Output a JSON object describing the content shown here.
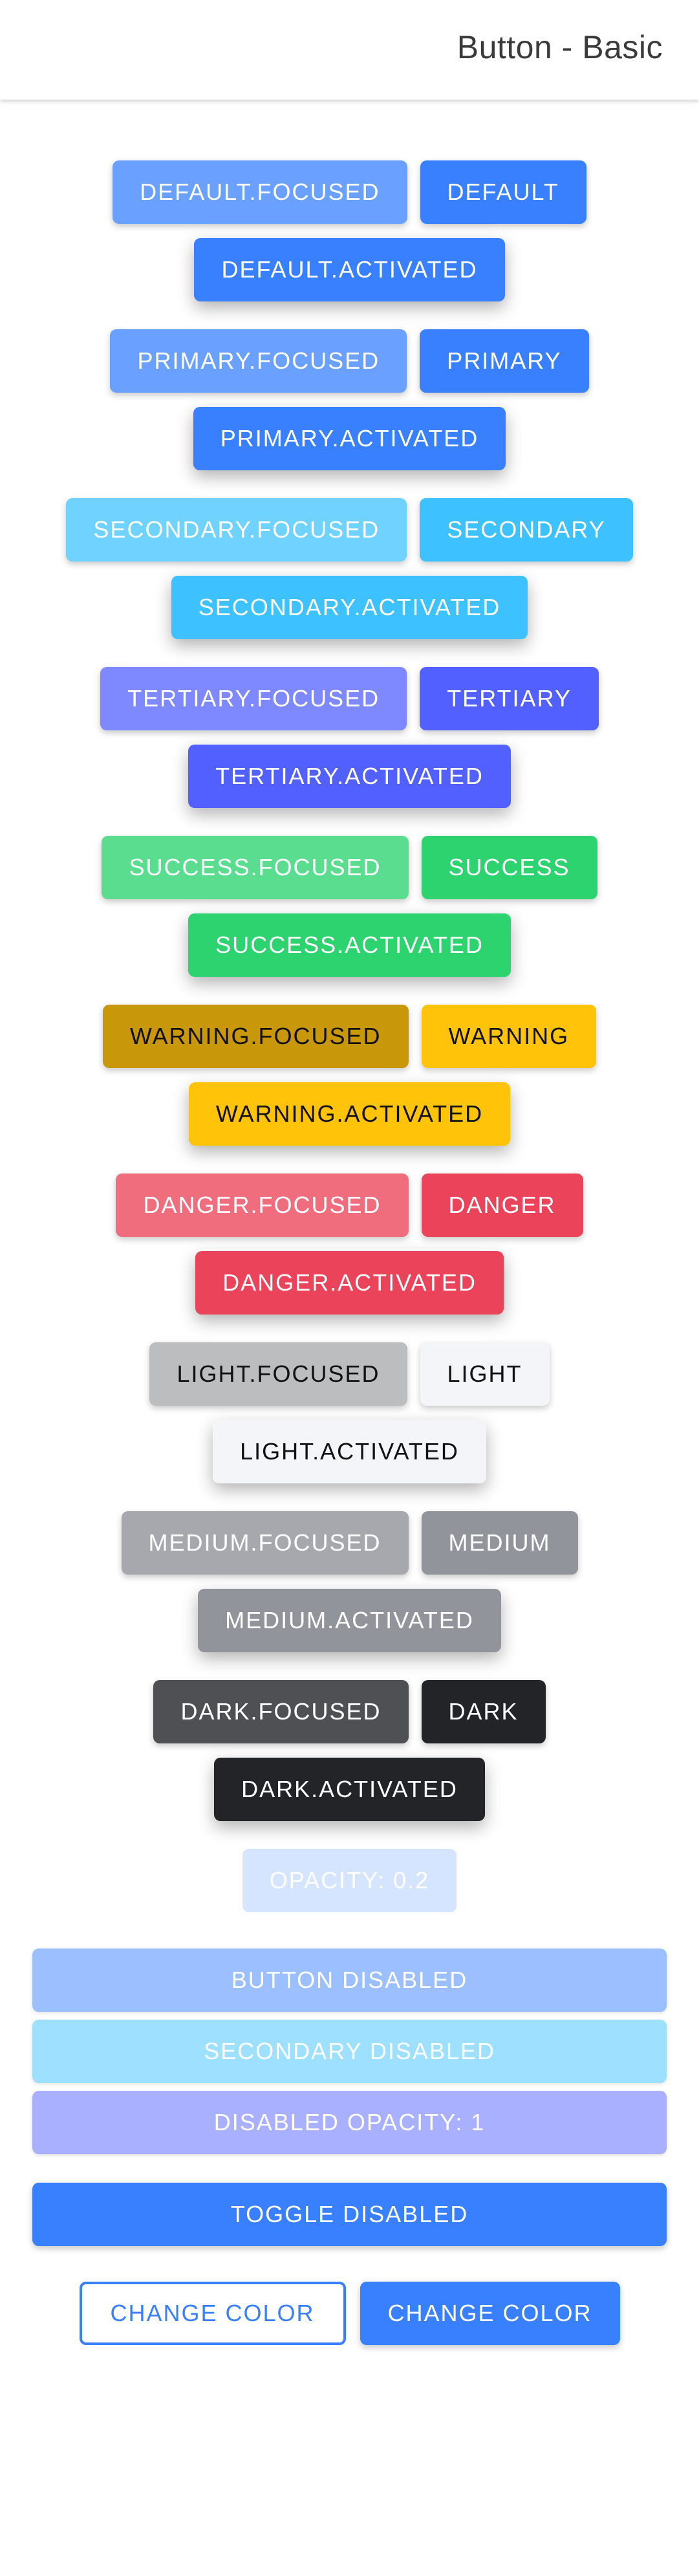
{
  "header": {
    "title": "Button - Basic"
  },
  "groups": [
    {
      "focused": "DEFAULT.FOCUSED",
      "base": "DEFAULT",
      "activated": "DEFAULT.ACTIVATED"
    },
    {
      "focused": "PRIMARY.FOCUSED",
      "base": "PRIMARY",
      "activated": "PRIMARY.ACTIVATED"
    },
    {
      "focused": "SECONDARY.FOCUSED",
      "base": "SECONDARY",
      "activated": "SECONDARY.ACTIVATED"
    },
    {
      "focused": "TERTIARY.FOCUSED",
      "base": "TERTIARY",
      "activated": "TERTIARY.ACTIVATED"
    },
    {
      "focused": "SUCCESS.FOCUSED",
      "base": "SUCCESS",
      "activated": "SUCCESS.ACTIVATED"
    },
    {
      "focused": "WARNING.FOCUSED",
      "base": "WARNING",
      "activated": "WARNING.ACTIVATED"
    },
    {
      "focused": "DANGER.FOCUSED",
      "base": "DANGER",
      "activated": "DANGER.ACTIVATED"
    },
    {
      "focused": "LIGHT.FOCUSED",
      "base": "LIGHT",
      "activated": "LIGHT.ACTIVATED"
    },
    {
      "focused": "MEDIUM.FOCUSED",
      "base": "MEDIUM",
      "activated": "MEDIUM.ACTIVATED"
    },
    {
      "focused": "DARK.FOCUSED",
      "base": "DARK",
      "activated": "DARK.ACTIVATED"
    }
  ],
  "opacity_button": "OPACITY: 0.2",
  "disabled": {
    "button": "BUTTON DISABLED",
    "secondary": "SECONDARY DISABLED",
    "opacity": "DISABLED OPACITY: 1"
  },
  "toggle_disabled": "TOGGLE DISABLED",
  "change_color": {
    "outline": "CHANGE COLOR",
    "solid": "CHANGE COLOR"
  },
  "colors": {
    "primary": "#3880ff",
    "secondary": "#3dc2ff",
    "tertiary": "#5260ff",
    "success": "#2dd36f",
    "warning": "#ffc409",
    "danger": "#eb445a",
    "light": "#f4f5f8",
    "medium": "#92949c",
    "dark": "#222428"
  }
}
